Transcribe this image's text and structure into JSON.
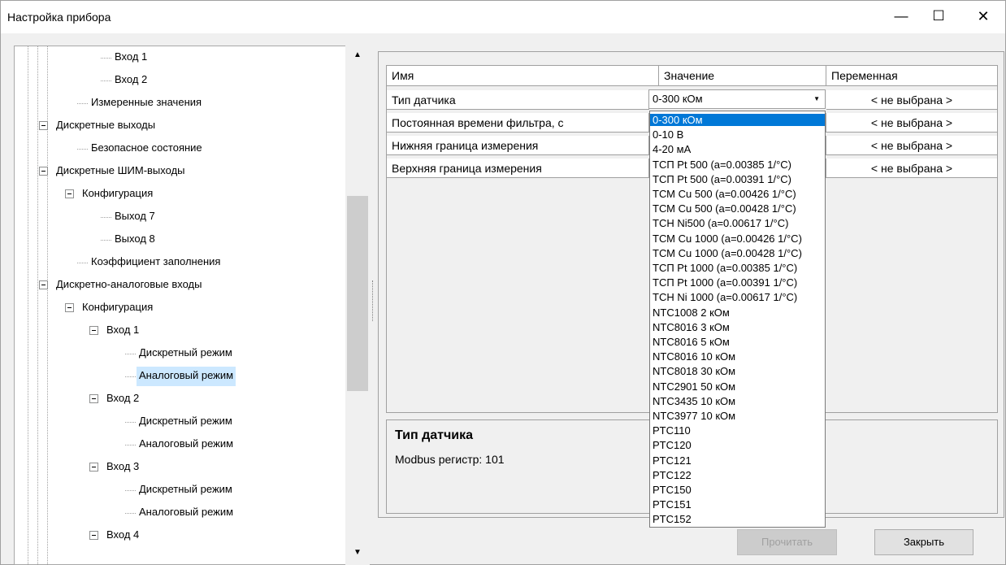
{
  "window": {
    "title": "Настройка прибора",
    "minimize_glyph": "—",
    "maximize_glyph": "☐",
    "close_glyph": "✕"
  },
  "tree": {
    "items": [
      {
        "label": "Вход 1",
        "level": 4
      },
      {
        "label": "Вход 2",
        "level": 4
      },
      {
        "label": "Измеренные значения",
        "level": 3
      },
      {
        "label": "Дискретные выходы",
        "level": 1
      },
      {
        "label": "Безопасное состояние",
        "level": 3
      },
      {
        "label": "Дискретные ШИМ-выходы",
        "level": 1
      },
      {
        "label": "Конфигурация",
        "level": 2
      },
      {
        "label": "Выход 7",
        "level": 4
      },
      {
        "label": "Выход 8",
        "level": 4
      },
      {
        "label": "Коэффициент заполнения",
        "level": 3
      },
      {
        "label": "Дискретно-аналоговые входы",
        "level": 1
      },
      {
        "label": "Конфигурация",
        "level": 2
      },
      {
        "label": "Вход 1",
        "level": 3
      },
      {
        "label": "Дискретный режим",
        "level": 5
      },
      {
        "label": "Аналоговый режим",
        "level": 5,
        "selected": true
      },
      {
        "label": "Вход 2",
        "level": 3
      },
      {
        "label": "Дискретный режим",
        "level": 5
      },
      {
        "label": "Аналоговый режим",
        "level": 5
      },
      {
        "label": "Вход 3",
        "level": 3
      },
      {
        "label": "Дискретный режим",
        "level": 5
      },
      {
        "label": "Аналоговый режим",
        "level": 5
      },
      {
        "label": "Вход 4",
        "level": 3
      }
    ],
    "scroll_up_glyph": "▲",
    "scroll_down_glyph": "▼"
  },
  "grid": {
    "columns": [
      "Имя",
      "Значение",
      "Переменная"
    ],
    "rows": [
      {
        "name": "Тип датчика",
        "value": "0-300 кОм",
        "variable": "< не выбрана >"
      },
      {
        "name": "Постоянная времени фильтра, с",
        "value": "",
        "variable": "< не выбрана >"
      },
      {
        "name": "Нижняя граница измерения",
        "value": "",
        "variable": "< не выбрана >"
      },
      {
        "name": "Верхняя граница измерения",
        "value": "",
        "variable": "< не выбрана >"
      }
    ],
    "combo_arrow": "▼"
  },
  "description": {
    "title": "Тип датчика",
    "text": "Modbus регистр: 101"
  },
  "dropdown": {
    "options": [
      "0-300 кОм",
      "0-10 В",
      "4-20 мА",
      "ТСП Pt 500 (a=0.00385 1/°C)",
      "ТСП Pt 500 (a=0.00391 1/°C)",
      "ТСМ Cu 500 (a=0.00426 1/°C)",
      "ТСМ Cu 500 (a=0.00428 1/°C)",
      "ТСН Ni500 (a=0.00617 1/°C)",
      "ТСМ Cu 1000 (a=0.00426 1/°C)",
      "ТСМ Cu 1000 (a=0.00428 1/°C)",
      "ТСП Pt 1000 (a=0.00385 1/°C)",
      "ТСП Pt 1000 (a=0.00391 1/°C)",
      "ТСН Ni 1000 (a=0.00617 1/°C)",
      "NTC1008 2 кОм",
      "NTC8016 3 кОм",
      "NTC8016 5 кОм",
      "NTC8016 10 кОм",
      "NTC8018 30 кОм",
      "NTC2901 50 кОм",
      "NTC3435 10 кОм",
      "NTC3977 10 кОм",
      "PTC110",
      "PTC120",
      "PTC121",
      "PTC122",
      "PTC150",
      "PTC151",
      "PTC152"
    ],
    "highlighted_index": 0
  },
  "buttons": {
    "read": "Прочитать",
    "close": "Закрыть"
  }
}
